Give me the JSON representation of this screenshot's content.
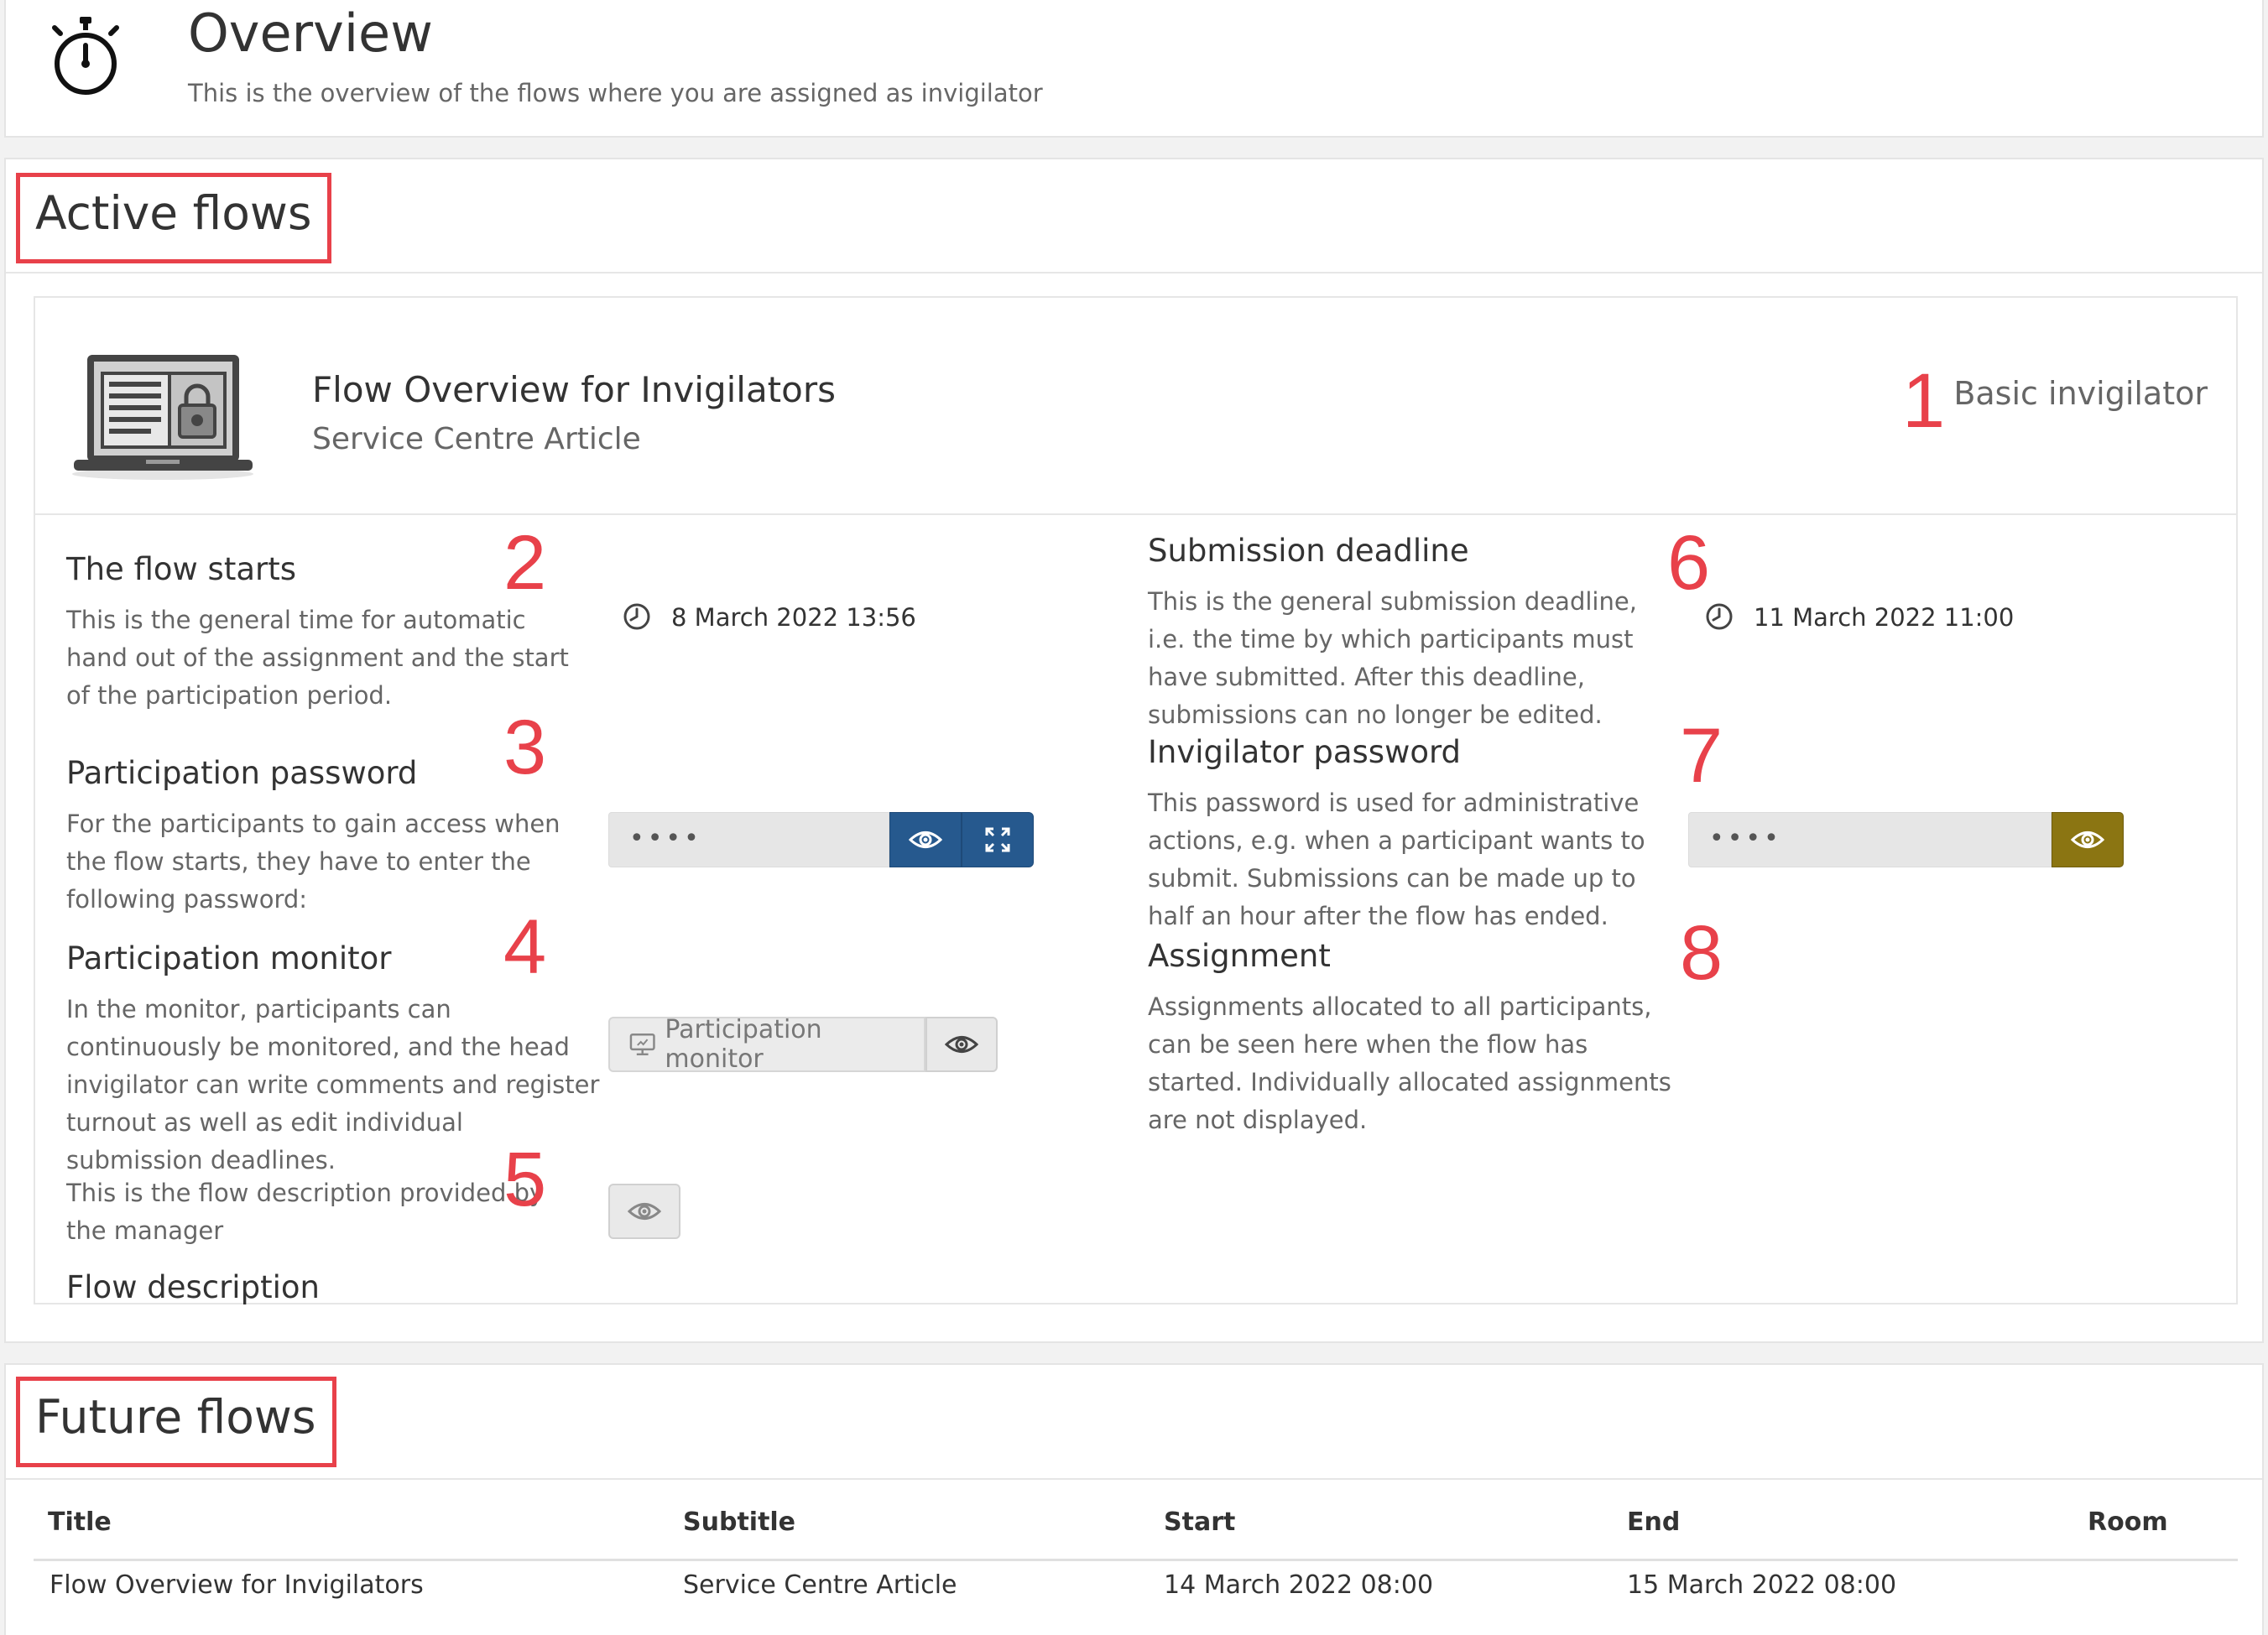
{
  "header": {
    "title": "Overview",
    "subtitle": "This is the overview of the flows where you are assigned as invigilator",
    "icon": "stopwatch-icon"
  },
  "active_flows": {
    "title": "Active flows",
    "flow": {
      "title": "Flow Overview for Invigilators",
      "subtitle": "Service Centre Article",
      "role": "Basic invigilator",
      "icon": "laptop-lock-icon"
    },
    "fields": {
      "flow_starts": {
        "title": "The flow starts",
        "description": "This is the general time for automatic hand out of the assignment and the start of the participation period.",
        "value": "8 March 2022 13:56"
      },
      "participation_password": {
        "title": "Participation password",
        "description": "For the participants to gain access when the flow starts, they have to enter the following password:",
        "value": "••••"
      },
      "participation_monitor": {
        "title": "Participation monitor",
        "description": "In the monitor, participants can continuously be monitored, and the head invigilator can write comments and register turnout as well as edit individual submission deadlines.",
        "button_label": "Participation monitor"
      },
      "flow_description": {
        "title": "Flow description",
        "description": "This is the flow description provided by the manager"
      },
      "submission_deadline": {
        "title": "Submission deadline",
        "description": "This is the general submission deadline, i.e. the time by which participants must have submitted. After this deadline, submissions can no longer be edited.",
        "value": "11 March 2022 11:00"
      },
      "invigilator_password": {
        "title": "Invigilator password",
        "description": "This password is used for administrative actions, e.g. when a participant wants to submit. Submissions can be made up to half an hour after the flow has ended.",
        "value": "••••"
      },
      "assignment": {
        "title": "Assignment",
        "description": "Assignments allocated to all participants, can be seen here when the flow has started. Individually allocated assignments are not displayed."
      }
    },
    "annotations": [
      "1",
      "2",
      "3",
      "4",
      "5",
      "6",
      "7",
      "8"
    ]
  },
  "future_flows": {
    "title": "Future flows",
    "columns": [
      "Title",
      "Subtitle",
      "Start",
      "End",
      "Room"
    ],
    "rows": [
      [
        "Flow Overview for Invigilators",
        "Service Centre Article",
        "14 March 2022 08:00",
        "15 March 2022 08:00",
        ""
      ]
    ]
  },
  "colors": {
    "annotation_red": "#e8414a",
    "primary_blue": "#26598e",
    "invigilator_gold": "#8b7512"
  }
}
